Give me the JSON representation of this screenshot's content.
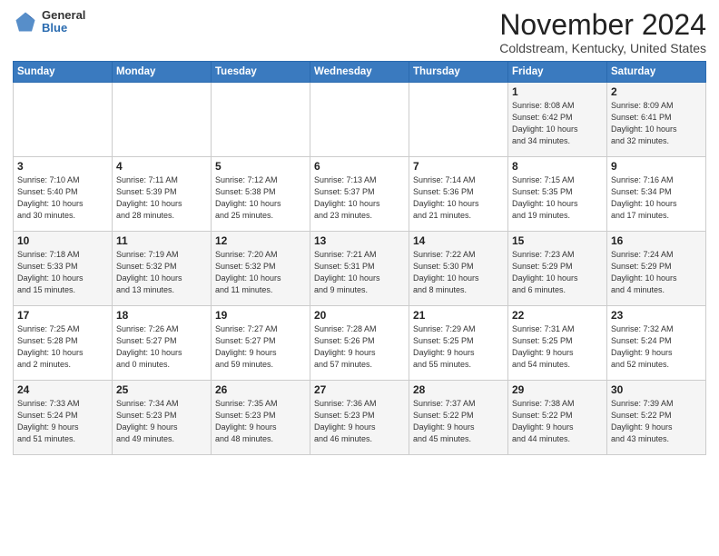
{
  "header": {
    "logo": {
      "general": "General",
      "blue": "Blue"
    },
    "title": "November 2024",
    "location": "Coldstream, Kentucky, United States"
  },
  "weekdays": [
    "Sunday",
    "Monday",
    "Tuesday",
    "Wednesday",
    "Thursday",
    "Friday",
    "Saturday"
  ],
  "weeks": [
    [
      {
        "day": "",
        "info": ""
      },
      {
        "day": "",
        "info": ""
      },
      {
        "day": "",
        "info": ""
      },
      {
        "day": "",
        "info": ""
      },
      {
        "day": "",
        "info": ""
      },
      {
        "day": "1",
        "info": "Sunrise: 8:08 AM\nSunset: 6:42 PM\nDaylight: 10 hours\nand 34 minutes."
      },
      {
        "day": "2",
        "info": "Sunrise: 8:09 AM\nSunset: 6:41 PM\nDaylight: 10 hours\nand 32 minutes."
      }
    ],
    [
      {
        "day": "3",
        "info": "Sunrise: 7:10 AM\nSunset: 5:40 PM\nDaylight: 10 hours\nand 30 minutes."
      },
      {
        "day": "4",
        "info": "Sunrise: 7:11 AM\nSunset: 5:39 PM\nDaylight: 10 hours\nand 28 minutes."
      },
      {
        "day": "5",
        "info": "Sunrise: 7:12 AM\nSunset: 5:38 PM\nDaylight: 10 hours\nand 25 minutes."
      },
      {
        "day": "6",
        "info": "Sunrise: 7:13 AM\nSunset: 5:37 PM\nDaylight: 10 hours\nand 23 minutes."
      },
      {
        "day": "7",
        "info": "Sunrise: 7:14 AM\nSunset: 5:36 PM\nDaylight: 10 hours\nand 21 minutes."
      },
      {
        "day": "8",
        "info": "Sunrise: 7:15 AM\nSunset: 5:35 PM\nDaylight: 10 hours\nand 19 minutes."
      },
      {
        "day": "9",
        "info": "Sunrise: 7:16 AM\nSunset: 5:34 PM\nDaylight: 10 hours\nand 17 minutes."
      }
    ],
    [
      {
        "day": "10",
        "info": "Sunrise: 7:18 AM\nSunset: 5:33 PM\nDaylight: 10 hours\nand 15 minutes."
      },
      {
        "day": "11",
        "info": "Sunrise: 7:19 AM\nSunset: 5:32 PM\nDaylight: 10 hours\nand 13 minutes."
      },
      {
        "day": "12",
        "info": "Sunrise: 7:20 AM\nSunset: 5:32 PM\nDaylight: 10 hours\nand 11 minutes."
      },
      {
        "day": "13",
        "info": "Sunrise: 7:21 AM\nSunset: 5:31 PM\nDaylight: 10 hours\nand 9 minutes."
      },
      {
        "day": "14",
        "info": "Sunrise: 7:22 AM\nSunset: 5:30 PM\nDaylight: 10 hours\nand 8 minutes."
      },
      {
        "day": "15",
        "info": "Sunrise: 7:23 AM\nSunset: 5:29 PM\nDaylight: 10 hours\nand 6 minutes."
      },
      {
        "day": "16",
        "info": "Sunrise: 7:24 AM\nSunset: 5:29 PM\nDaylight: 10 hours\nand 4 minutes."
      }
    ],
    [
      {
        "day": "17",
        "info": "Sunrise: 7:25 AM\nSunset: 5:28 PM\nDaylight: 10 hours\nand 2 minutes."
      },
      {
        "day": "18",
        "info": "Sunrise: 7:26 AM\nSunset: 5:27 PM\nDaylight: 10 hours\nand 0 minutes."
      },
      {
        "day": "19",
        "info": "Sunrise: 7:27 AM\nSunset: 5:27 PM\nDaylight: 9 hours\nand 59 minutes."
      },
      {
        "day": "20",
        "info": "Sunrise: 7:28 AM\nSunset: 5:26 PM\nDaylight: 9 hours\nand 57 minutes."
      },
      {
        "day": "21",
        "info": "Sunrise: 7:29 AM\nSunset: 5:25 PM\nDaylight: 9 hours\nand 55 minutes."
      },
      {
        "day": "22",
        "info": "Sunrise: 7:31 AM\nSunset: 5:25 PM\nDaylight: 9 hours\nand 54 minutes."
      },
      {
        "day": "23",
        "info": "Sunrise: 7:32 AM\nSunset: 5:24 PM\nDaylight: 9 hours\nand 52 minutes."
      }
    ],
    [
      {
        "day": "24",
        "info": "Sunrise: 7:33 AM\nSunset: 5:24 PM\nDaylight: 9 hours\nand 51 minutes."
      },
      {
        "day": "25",
        "info": "Sunrise: 7:34 AM\nSunset: 5:23 PM\nDaylight: 9 hours\nand 49 minutes."
      },
      {
        "day": "26",
        "info": "Sunrise: 7:35 AM\nSunset: 5:23 PM\nDaylight: 9 hours\nand 48 minutes."
      },
      {
        "day": "27",
        "info": "Sunrise: 7:36 AM\nSunset: 5:23 PM\nDaylight: 9 hours\nand 46 minutes."
      },
      {
        "day": "28",
        "info": "Sunrise: 7:37 AM\nSunset: 5:22 PM\nDaylight: 9 hours\nand 45 minutes."
      },
      {
        "day": "29",
        "info": "Sunrise: 7:38 AM\nSunset: 5:22 PM\nDaylight: 9 hours\nand 44 minutes."
      },
      {
        "day": "30",
        "info": "Sunrise: 7:39 AM\nSunset: 5:22 PM\nDaylight: 9 hours\nand 43 minutes."
      }
    ]
  ]
}
